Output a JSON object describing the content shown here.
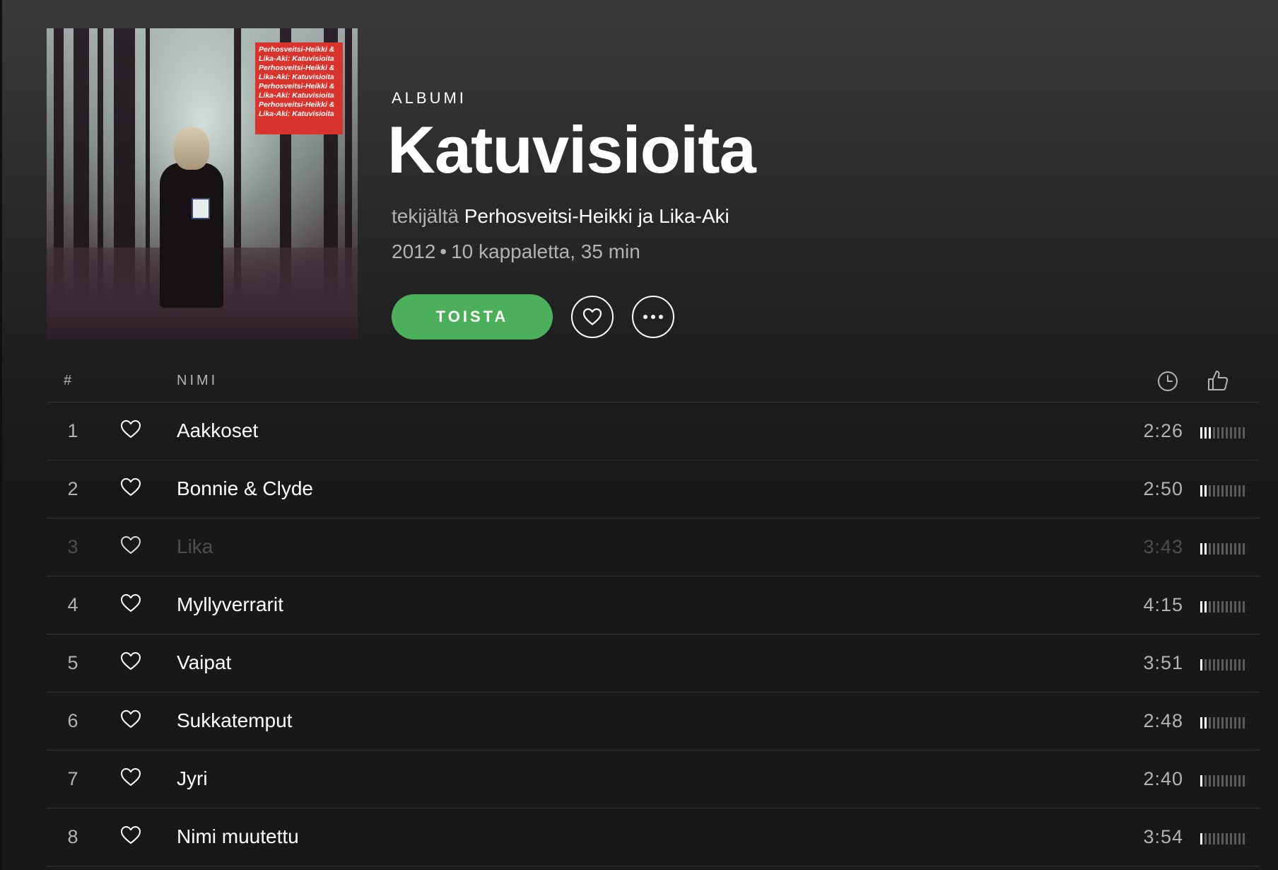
{
  "album": {
    "type_label": "ALBUMI",
    "title": "Katuvisioita",
    "by_prefix": "tekijältä",
    "artist": "Perhosveitsi-Heikki ja Lika-Aki",
    "year": "2012",
    "separator": "•",
    "summary": "10 kappaletta, 35 min",
    "cover_text": "Perhosveitsi-Heikki & Lika-Aki: Katuvisioita Perhosveitsi-Heikki & Lika-Aki: Katuvisioita Perhosveitsi-Heikki & Lika-Aki: Katuvisioita Perhosveitsi-Heikki & Lika-Aki: Katuvisioita",
    "cover_label_color": "#d8342d"
  },
  "actions": {
    "play_label": "TOISTA",
    "like_icon": "heart-icon",
    "more_icon": "more-icon"
  },
  "colors": {
    "accent": "#4caf5a",
    "background": "#181818",
    "text_primary": "#ffffff",
    "text_secondary": "#b3b3b3",
    "text_disabled": "#4e4e4e"
  },
  "tracklist": {
    "header": {
      "number_label": "#",
      "name_label": "NIMI",
      "duration_icon": "clock-icon",
      "popularity_icon": "thumbs-up-icon"
    },
    "tracks": [
      {
        "number": "1",
        "title": "Aakkoset",
        "duration": "2:26",
        "popularity": 0.3,
        "available": true
      },
      {
        "number": "2",
        "title": "Bonnie & Clyde",
        "duration": "2:50",
        "popularity": 0.2,
        "available": true
      },
      {
        "number": "3",
        "title": "Lika",
        "duration": "3:43",
        "popularity": 0.2,
        "available": false
      },
      {
        "number": "4",
        "title": "Myllyverrarit",
        "duration": "4:15",
        "popularity": 0.2,
        "available": true
      },
      {
        "number": "5",
        "title": "Vaipat",
        "duration": "3:51",
        "popularity": 0.1,
        "available": true
      },
      {
        "number": "6",
        "title": "Sukkatemput",
        "duration": "2:48",
        "popularity": 0.2,
        "available": true
      },
      {
        "number": "7",
        "title": "Jyri",
        "duration": "2:40",
        "popularity": 0.1,
        "available": true
      },
      {
        "number": "8",
        "title": "Nimi muutettu",
        "duration": "3:54",
        "popularity": 0.1,
        "available": true
      }
    ]
  }
}
